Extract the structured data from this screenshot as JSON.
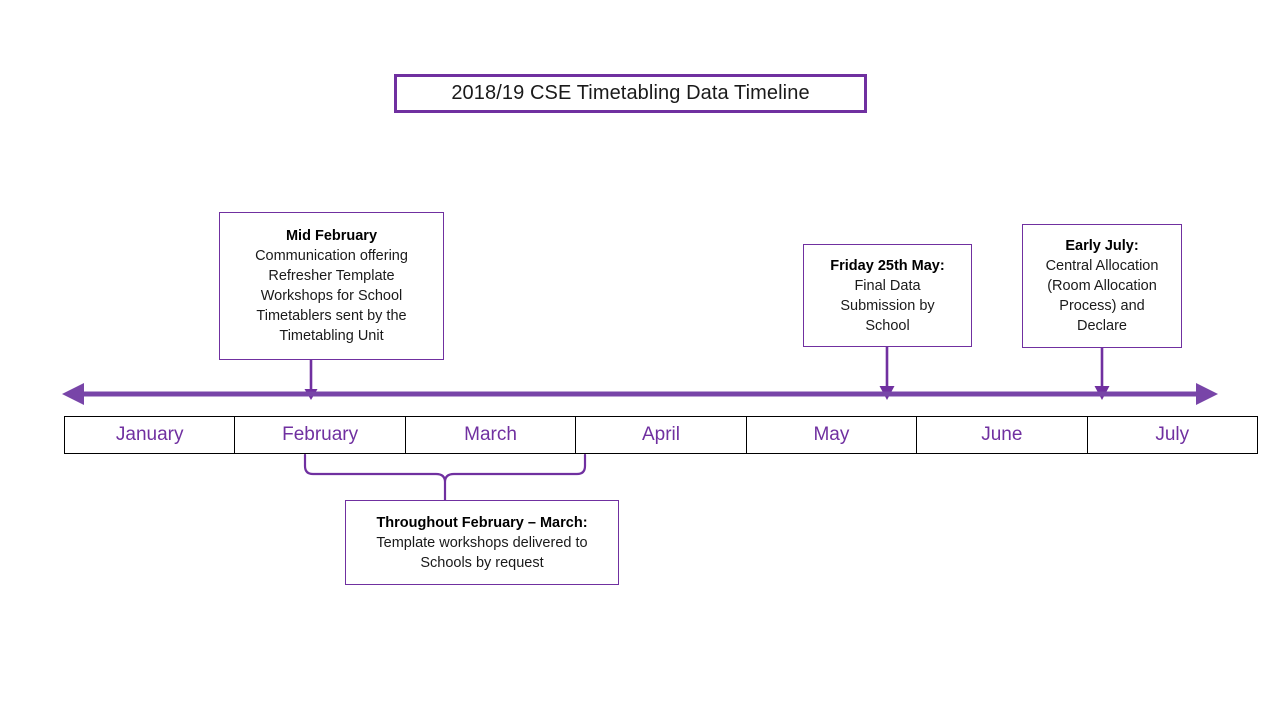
{
  "title": {
    "text": "2018/19 CSE Timetabling Data Timeline"
  },
  "colors": {
    "accent_purple": "#7030A0",
    "axis_purple": "#7845A8",
    "month_label": "#7030A0",
    "box_border": "#7030A0",
    "bar_border": "#000000",
    "background": "#FFFFFF",
    "text": "#000000"
  },
  "timeline": {
    "axis": {
      "style": "double-headed-arrow",
      "direction": "both"
    },
    "months": [
      {
        "label": "January"
      },
      {
        "label": "February"
      },
      {
        "label": "March"
      },
      {
        "label": "April"
      },
      {
        "label": "May"
      },
      {
        "label": "June"
      },
      {
        "label": "July"
      }
    ]
  },
  "callouts": [
    {
      "id": "mid-february",
      "headline": "Mid February",
      "lines": [
        "Communication offering",
        "Refresher Template",
        "Workshops for School",
        "Timetablers sent by the",
        "Timetabling Unit"
      ],
      "anchor_month": "February",
      "position": "above"
    },
    {
      "id": "friday-25th-may",
      "headline": "Friday 25th May:",
      "lines": [
        "Final Data",
        "Submission by",
        "School"
      ],
      "anchor_month": "May",
      "position": "above"
    },
    {
      "id": "early-july",
      "headline": "Early July:",
      "lines": [
        "Central Allocation",
        "(Room Allocation",
        "Process) and",
        "Declare"
      ],
      "anchor_month": "July",
      "position": "above"
    },
    {
      "id": "throughout-february-march",
      "headline": "Throughout February – March:",
      "lines": [
        "Template workshops delivered to",
        "Schools by request"
      ],
      "anchor_months": "February – March",
      "position": "below"
    }
  ]
}
